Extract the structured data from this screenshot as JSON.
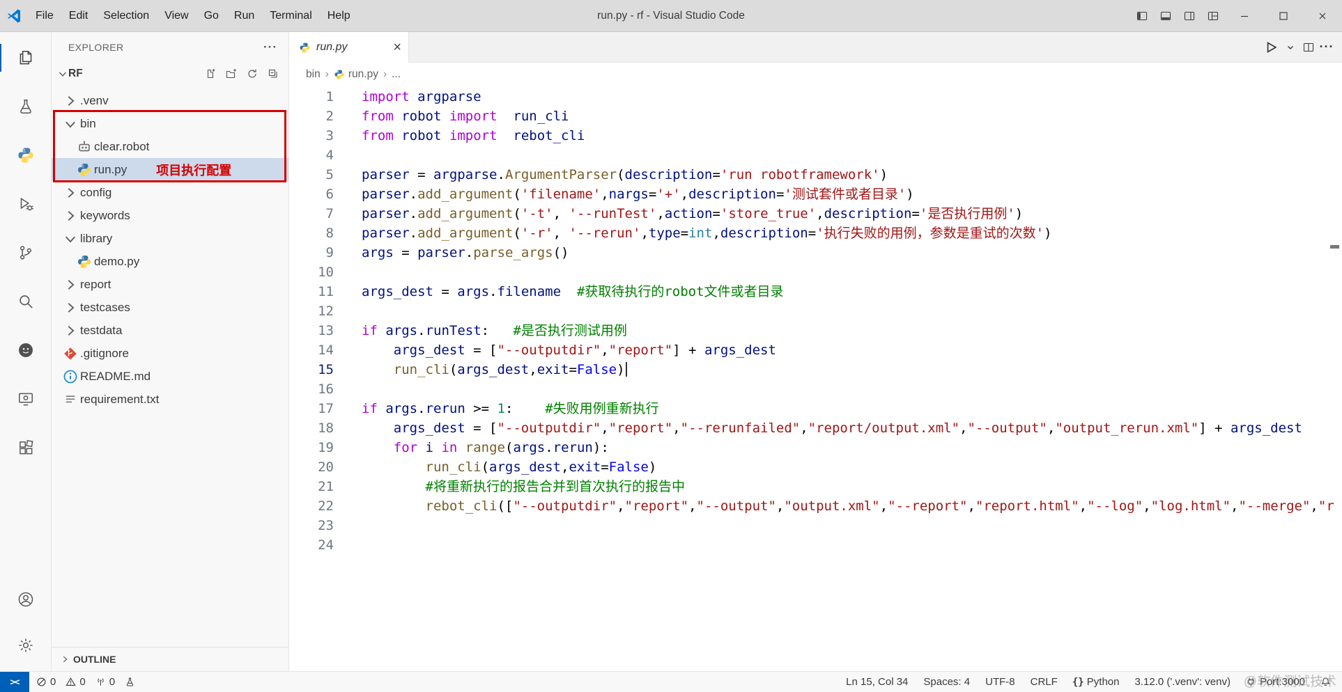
{
  "titlebar": {
    "title": "run.py - rf - Visual Studio Code",
    "menus": [
      "File",
      "Edit",
      "Selection",
      "View",
      "Go",
      "Run",
      "Terminal",
      "Help"
    ],
    "layout_controls": [
      {
        "name": "toggle-primary-sidebar",
        "icon": "sideL"
      },
      {
        "name": "toggle-panel",
        "icon": "panel"
      },
      {
        "name": "toggle-secondary-sidebar",
        "icon": "sideR"
      },
      {
        "name": "customize-layout",
        "icon": "layout"
      }
    ],
    "window_controls": [
      {
        "name": "minimize-button",
        "icon": "min"
      },
      {
        "name": "maximize-button",
        "icon": "max"
      },
      {
        "name": "close-button",
        "icon": "close"
      }
    ]
  },
  "activity_bar": {
    "top": [
      {
        "name": "explorer",
        "icon": "files",
        "active": true
      },
      {
        "name": "testing",
        "icon": "beaker"
      },
      {
        "name": "python-extension",
        "icon": "pythonLogo"
      },
      {
        "name": "run-and-debug",
        "icon": "debug"
      },
      {
        "name": "source-control",
        "icon": "scm"
      },
      {
        "name": "search",
        "icon": "search"
      },
      {
        "name": "robot-framework-extension",
        "icon": "darkCircle"
      },
      {
        "name": "remote-explorer",
        "icon": "remote"
      },
      {
        "name": "extensions",
        "icon": "extensions"
      }
    ],
    "bottom": [
      {
        "name": "accounts",
        "icon": "account"
      },
      {
        "name": "manage",
        "icon": "gear"
      }
    ]
  },
  "explorer": {
    "header": "EXPLORER",
    "header_more": "···",
    "section": "RF",
    "section_actions": [
      {
        "name": "new-file",
        "icon": "newFile"
      },
      {
        "name": "new-folder",
        "icon": "newFolder"
      },
      {
        "name": "refresh-explorer",
        "icon": "refresh"
      },
      {
        "name": "collapse-folders",
        "icon": "collapse"
      }
    ],
    "tree": [
      {
        "label": ".venv",
        "type": "folder",
        "chevron": "right",
        "indent": 0
      },
      {
        "label": "bin",
        "type": "folder",
        "chevron": "down",
        "indent": 0
      },
      {
        "label": "clear.robot",
        "type": "robot",
        "indent": 1
      },
      {
        "label": "run.py",
        "type": "python",
        "indent": 1,
        "selected": true,
        "annotation": "项目执行配置"
      },
      {
        "label": "config",
        "type": "folder",
        "chevron": "right",
        "indent": 0
      },
      {
        "label": "keywords",
        "type": "folder",
        "chevron": "right",
        "indent": 0
      },
      {
        "label": "library",
        "type": "folder",
        "chevron": "down",
        "indent": 0
      },
      {
        "label": "demo.py",
        "type": "python",
        "indent": 1
      },
      {
        "label": "report",
        "type": "folder",
        "chevron": "right",
        "indent": 0
      },
      {
        "label": "testcases",
        "type": "folder",
        "chevron": "right",
        "indent": 0
      },
      {
        "label": "testdata",
        "type": "folder",
        "chevron": "right",
        "indent": 0
      },
      {
        "label": ".gitignore",
        "type": "git",
        "indent": 0
      },
      {
        "label": "README.md",
        "type": "info",
        "indent": 0
      },
      {
        "label": "requirement.txt",
        "type": "text",
        "indent": 0
      }
    ],
    "outline": "OUTLINE"
  },
  "editor": {
    "tab": {
      "label": "run.py"
    },
    "actions": [
      {
        "name": "run-python-file",
        "icon": "run"
      },
      {
        "name": "run-dropdown",
        "icon": "chevSmall"
      },
      {
        "name": "split-editor",
        "icon": "split"
      },
      {
        "name": "editor-more-actions",
        "icon": "moreDots"
      }
    ],
    "breadcrumb": [
      {
        "label": "bin"
      },
      {
        "label": "run.py",
        "icon": "python"
      },
      {
        "label": "..."
      }
    ],
    "active_line": 15,
    "cursor": {
      "line": 15,
      "col": 34
    },
    "lines": [
      [
        [
          "k",
          "import"
        ],
        [
          "d",
          " "
        ],
        [
          "v",
          "argparse"
        ]
      ],
      [
        [
          "k",
          "from"
        ],
        [
          "d",
          " "
        ],
        [
          "v",
          "robot"
        ],
        [
          "d",
          " "
        ],
        [
          "k",
          "import"
        ],
        [
          "d",
          "  "
        ],
        [
          "v",
          "run_cli"
        ]
      ],
      [
        [
          "k",
          "from"
        ],
        [
          "d",
          " "
        ],
        [
          "v",
          "robot"
        ],
        [
          "d",
          " "
        ],
        [
          "k",
          "import"
        ],
        [
          "d",
          "  "
        ],
        [
          "v",
          "rebot_cli"
        ]
      ],
      [],
      [
        [
          "v",
          "parser"
        ],
        [
          "d",
          " = "
        ],
        [
          "v",
          "argparse"
        ],
        [
          "d",
          "."
        ],
        [
          "f",
          "ArgumentParser"
        ],
        [
          "d",
          "("
        ],
        [
          "v",
          "description"
        ],
        [
          "d",
          "="
        ],
        [
          "s",
          "'run robotframework'"
        ],
        [
          "d",
          ")"
        ]
      ],
      [
        [
          "v",
          "parser"
        ],
        [
          "d",
          "."
        ],
        [
          "f",
          "add_argument"
        ],
        [
          "d",
          "("
        ],
        [
          "s",
          "'filename'"
        ],
        [
          "d",
          ","
        ],
        [
          "v",
          "nargs"
        ],
        [
          "d",
          "="
        ],
        [
          "s",
          "'+'"
        ],
        [
          "d",
          ","
        ],
        [
          "v",
          "description"
        ],
        [
          "d",
          "="
        ],
        [
          "s",
          "'测试套件或者目录'"
        ],
        [
          "d",
          ")"
        ]
      ],
      [
        [
          "v",
          "parser"
        ],
        [
          "d",
          "."
        ],
        [
          "f",
          "add_argument"
        ],
        [
          "d",
          "("
        ],
        [
          "s",
          "'-t'"
        ],
        [
          "d",
          ", "
        ],
        [
          "s",
          "'--runTest'"
        ],
        [
          "d",
          ","
        ],
        [
          "v",
          "action"
        ],
        [
          "d",
          "="
        ],
        [
          "s",
          "'store_true'"
        ],
        [
          "d",
          ","
        ],
        [
          "v",
          "description"
        ],
        [
          "d",
          "="
        ],
        [
          "s",
          "'是否执行用例'"
        ],
        [
          "d",
          ")"
        ]
      ],
      [
        [
          "v",
          "parser"
        ],
        [
          "d",
          "."
        ],
        [
          "f",
          "add_argument"
        ],
        [
          "d",
          "("
        ],
        [
          "s",
          "'-r'"
        ],
        [
          "d",
          ", "
        ],
        [
          "s",
          "'--rerun'"
        ],
        [
          "d",
          ","
        ],
        [
          "v",
          "type"
        ],
        [
          "d",
          "="
        ],
        [
          "t",
          "int"
        ],
        [
          "d",
          ","
        ],
        [
          "v",
          "description"
        ],
        [
          "d",
          "="
        ],
        [
          "s",
          "'执行失败的用例，参数是重试的次数'"
        ],
        [
          "d",
          ")"
        ]
      ],
      [
        [
          "v",
          "args"
        ],
        [
          "d",
          " = "
        ],
        [
          "v",
          "parser"
        ],
        [
          "d",
          "."
        ],
        [
          "f",
          "parse_args"
        ],
        [
          "d",
          "()"
        ]
      ],
      [],
      [
        [
          "v",
          "args_dest"
        ],
        [
          "d",
          " = "
        ],
        [
          "v",
          "args"
        ],
        [
          "d",
          "."
        ],
        [
          "v",
          "filename"
        ],
        [
          "d",
          "  "
        ],
        [
          "c",
          "#获取待执行的robot文件或者目录"
        ]
      ],
      [],
      [
        [
          "k",
          "if"
        ],
        [
          "d",
          " "
        ],
        [
          "v",
          "args"
        ],
        [
          "d",
          "."
        ],
        [
          "v",
          "runTest"
        ],
        [
          "d",
          ":   "
        ],
        [
          "c",
          "#是否执行测试用例"
        ]
      ],
      [
        [
          "d",
          "    "
        ],
        [
          "v",
          "args_dest"
        ],
        [
          "d",
          " = ["
        ],
        [
          "s",
          "\"--outputdir\""
        ],
        [
          "d",
          ","
        ],
        [
          "s",
          "\"report\""
        ],
        [
          "d",
          "] + "
        ],
        [
          "v",
          "args_dest"
        ]
      ],
      [
        [
          "d",
          "    "
        ],
        [
          "f",
          "run_cli"
        ],
        [
          "d",
          "("
        ],
        [
          "v",
          "args_dest"
        ],
        [
          "d",
          ","
        ],
        [
          "v",
          "exit"
        ],
        [
          "d",
          "="
        ],
        [
          "b",
          "False"
        ],
        [
          "d",
          ")"
        ]
      ],
      [],
      [
        [
          "k",
          "if"
        ],
        [
          "d",
          " "
        ],
        [
          "v",
          "args"
        ],
        [
          "d",
          "."
        ],
        [
          "v",
          "rerun"
        ],
        [
          "d",
          " >= "
        ],
        [
          "n",
          "1"
        ],
        [
          "d",
          ":    "
        ],
        [
          "c",
          "#失败用例重新执行"
        ]
      ],
      [
        [
          "d",
          "    "
        ],
        [
          "v",
          "args_dest"
        ],
        [
          "d",
          " = ["
        ],
        [
          "s",
          "\"--outputdir\""
        ],
        [
          "d",
          ","
        ],
        [
          "s",
          "\"report\""
        ],
        [
          "d",
          ","
        ],
        [
          "s",
          "\"--rerunfailed\""
        ],
        [
          "d",
          ","
        ],
        [
          "s",
          "\"report/output.xml\""
        ],
        [
          "d",
          ","
        ],
        [
          "s",
          "\"--output\""
        ],
        [
          "d",
          ","
        ],
        [
          "s",
          "\"output_rerun.xml\""
        ],
        [
          "d",
          "] + "
        ],
        [
          "v",
          "args_dest"
        ]
      ],
      [
        [
          "d",
          "    "
        ],
        [
          "k",
          "for"
        ],
        [
          "d",
          " "
        ],
        [
          "v",
          "i"
        ],
        [
          "d",
          " "
        ],
        [
          "k",
          "in"
        ],
        [
          "d",
          " "
        ],
        [
          "f",
          "range"
        ],
        [
          "d",
          "("
        ],
        [
          "v",
          "args"
        ],
        [
          "d",
          "."
        ],
        [
          "v",
          "rerun"
        ],
        [
          "d",
          "):"
        ]
      ],
      [
        [
          "d",
          "        "
        ],
        [
          "f",
          "run_cli"
        ],
        [
          "d",
          "("
        ],
        [
          "v",
          "args_dest"
        ],
        [
          "d",
          ","
        ],
        [
          "v",
          "exit"
        ],
        [
          "d",
          "="
        ],
        [
          "b",
          "False"
        ],
        [
          "d",
          ")"
        ]
      ],
      [
        [
          "d",
          "        "
        ],
        [
          "c",
          "#将重新执行的报告合并到首次执行的报告中"
        ]
      ],
      [
        [
          "d",
          "        "
        ],
        [
          "f",
          "rebot_cli"
        ],
        [
          "d",
          "(["
        ],
        [
          "s",
          "\"--outputdir\""
        ],
        [
          "d",
          ","
        ],
        [
          "s",
          "\"report\""
        ],
        [
          "d",
          ","
        ],
        [
          "s",
          "\"--output\""
        ],
        [
          "d",
          ","
        ],
        [
          "s",
          "\"output.xml\""
        ],
        [
          "d",
          ","
        ],
        [
          "s",
          "\"--report\""
        ],
        [
          "d",
          ","
        ],
        [
          "s",
          "\"report.html\""
        ],
        [
          "d",
          ","
        ],
        [
          "s",
          "\"--log\""
        ],
        [
          "d",
          ","
        ],
        [
          "s",
          "\"log.html\""
        ],
        [
          "d",
          ","
        ],
        [
          "s",
          "\"--merge\""
        ],
        [
          "d",
          ","
        ],
        [
          "s",
          "\"r"
        ]
      ],
      [],
      []
    ]
  },
  "statusbar": {
    "remote_label": "><",
    "left": [
      {
        "name": "problems-errors",
        "icon": "error",
        "label": "0"
      },
      {
        "name": "problems-warnings",
        "icon": "warning",
        "label": "0"
      },
      {
        "name": "forwarded-ports",
        "icon": "radio",
        "label": "0"
      },
      {
        "name": "testing-status",
        "icon": "beakerSmall",
        "label": ""
      }
    ],
    "right": [
      {
        "name": "cursor-position",
        "label": "Ln 15, Col 34"
      },
      {
        "name": "indentation",
        "label": "Spaces: 4"
      },
      {
        "name": "encoding",
        "label": "UTF-8"
      },
      {
        "name": "eol-sequence",
        "label": "CRLF"
      },
      {
        "name": "language-mode",
        "icon": "braces",
        "label": "Python"
      },
      {
        "name": "python-interpreter",
        "label": "3.12.0 ('.venv': venv)"
      },
      {
        "name": "port",
        "icon": "plug",
        "label": "Port:3000"
      },
      {
        "name": "notifications",
        "icon": "bell",
        "label": ""
      }
    ],
    "watermark": "@软件测试技术"
  }
}
